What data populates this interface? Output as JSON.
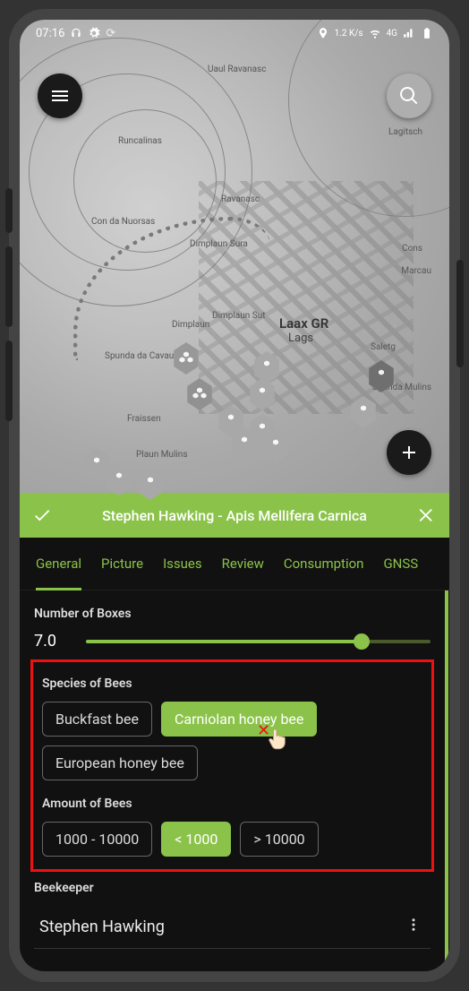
{
  "statusbar": {
    "time": "07:16",
    "network_rate": "1.2 K/s"
  },
  "header": {
    "title": "Stephen Hawking - Apis Mellifera Carnica"
  },
  "tabs": [
    "General",
    "Picture",
    "Issues",
    "Review",
    "Consumption",
    "GNSS"
  ],
  "active_tab": 0,
  "map": {
    "town_label": "Laax GR",
    "town_sub": "Lags",
    "labels": [
      "Uaul Ravanasc",
      "Runcalinas",
      "Ravanasc",
      "Con da Nuorsas",
      "Dimplaun Sura",
      "Dimplaun",
      "Dimplaun Sut",
      "Spunda da Cavaus",
      "Fraissen",
      "Plaun Mulins",
      "Cons",
      "Marcau",
      "Saletg",
      "Spunda Mulins",
      "Lagitsch"
    ]
  },
  "fields": {
    "boxes_label": "Number of Boxes",
    "boxes_value": "7.0",
    "species_label": "Species of Bees",
    "species_options": [
      "Buckfast bee",
      "Carniolan honey bee",
      "European honey bee"
    ],
    "species_selected": 1,
    "amount_label": "Amount of Bees",
    "amount_options": [
      "1000 - 10000",
      "< 1000",
      "> 10000"
    ],
    "amount_selected": 1,
    "beekeeper_label": "Beekeeper",
    "beekeeper_value": "Stephen Hawking"
  },
  "colors": {
    "accent": "#8bc34a"
  }
}
